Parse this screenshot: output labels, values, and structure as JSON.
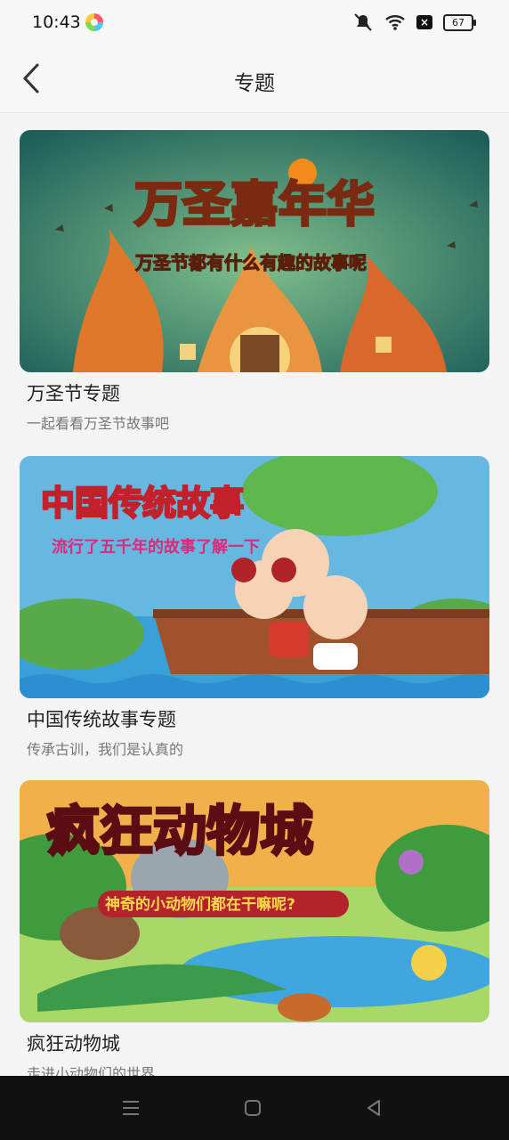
{
  "status_bar": {
    "time": "10:43",
    "battery": "67"
  },
  "header": {
    "title": "专题"
  },
  "topics": [
    {
      "banner_text": "万圣嘉年华",
      "banner_subtext": "万圣节都有什么有趣的故事呢",
      "title": "万圣节专题",
      "subtitle": "一起看看万圣节故事吧"
    },
    {
      "banner_text": "中国传统故事",
      "banner_subtext": "流行了五千年的故事了解一下",
      "title": "中国传统故事专题",
      "subtitle": "传承古训，我们是认真的"
    },
    {
      "banner_text": "疯狂动物城",
      "banner_subtext": "神奇的小动物们都在干嘛呢?",
      "title": "疯狂动物城",
      "subtitle": "走进小动物们的世界"
    }
  ]
}
